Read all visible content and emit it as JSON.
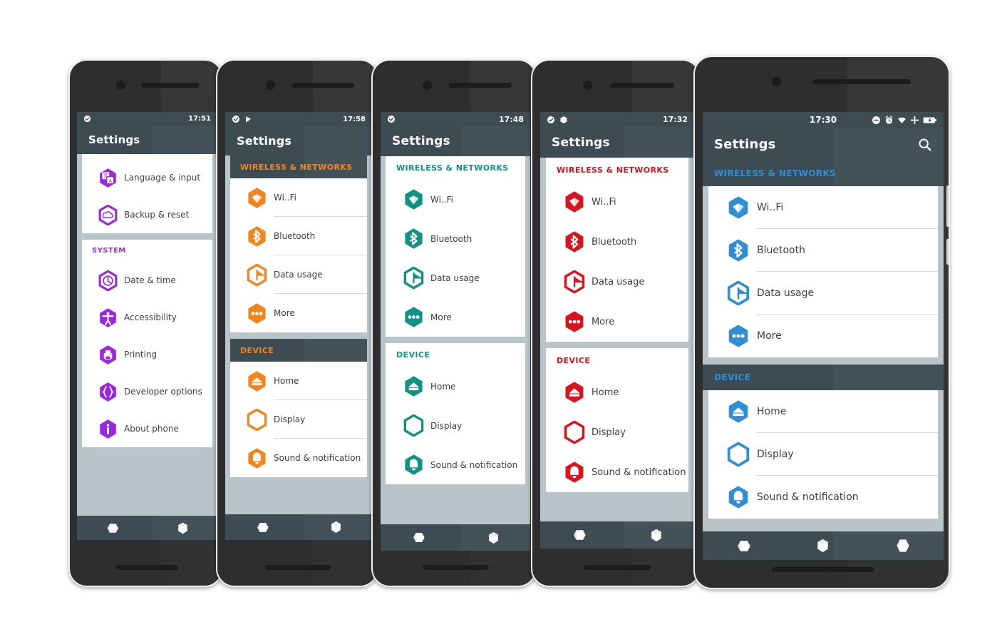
{
  "theme_colors": {
    "purple": "#9C27E0",
    "orange": "#F2851E",
    "teal": "#0E9384",
    "red": "#D91420",
    "blue": "#2E8ED6",
    "bar": "#3d4c52",
    "screen_bg": "#b9c4c9",
    "card": "#ffffff",
    "label": "#3a3f44",
    "divider": "#d8d8d8"
  },
  "section_labels": {
    "wireless": "WIRELESS & NETWORKS",
    "device": "DEVICE",
    "system": "SYSTEM"
  },
  "item_labels": {
    "wifi": "Wi..Fi",
    "bluetooth": "Bluetooth",
    "data_usage": "Data usage",
    "more": "More",
    "home": "Home",
    "display": "Display",
    "sound": "Sound & notification",
    "language": "Language & input",
    "backup": "Backup & reset",
    "datetime": "Date & time",
    "accessibility": "Accessibility",
    "printing": "Printing",
    "developer": "Developer options",
    "about": "About phone"
  },
  "phones": [
    {
      "id": "phone-purple",
      "accent": "#9C27E0",
      "title": "Settings",
      "time": "17:51",
      "status_left": [
        "check-circle-icon"
      ],
      "status_right": [],
      "search_visible": false,
      "section_header_style": "plain-card",
      "dividers": false,
      "nav_buttons": [
        "nav-back",
        "nav-home"
      ],
      "groups": [
        {
          "header": null,
          "items": [
            {
              "icon": "language-icon",
              "label": "Language & input"
            },
            {
              "icon": "backup-icon",
              "label": "Backup & reset"
            }
          ]
        },
        {
          "header": "SYSTEM",
          "items": [
            {
              "icon": "clock-icon",
              "label": "Date & time"
            },
            {
              "icon": "accessibility-icon",
              "label": "Accessibility"
            },
            {
              "icon": "printer-icon",
              "label": "Printing"
            },
            {
              "icon": "braces-icon",
              "label": "Developer options"
            },
            {
              "icon": "info-icon",
              "label": "About phone"
            }
          ]
        }
      ]
    },
    {
      "id": "phone-orange",
      "accent": "#F2851E",
      "title": "Settings",
      "time": "17:58",
      "status_left": [
        "check-circle-icon",
        "play-store-icon"
      ],
      "status_right": [],
      "search_visible": false,
      "section_header_style": "dark-band",
      "dividers": true,
      "nav_buttons": [
        "nav-back",
        "nav-home"
      ],
      "groups": [
        {
          "header": "WIRELESS & NETWORKS",
          "items": [
            {
              "icon": "wifi-icon",
              "label": "Wi..Fi"
            },
            {
              "icon": "bluetooth-icon",
              "label": "Bluetooth"
            },
            {
              "icon": "data-usage-icon",
              "label": "Data usage"
            },
            {
              "icon": "more-icon",
              "label": "More"
            }
          ]
        },
        {
          "header": "DEVICE",
          "items": [
            {
              "icon": "home-icon",
              "label": "Home"
            },
            {
              "icon": "display-icon",
              "label": "Display"
            },
            {
              "icon": "bell-icon",
              "label": "Sound & notification"
            }
          ]
        }
      ]
    },
    {
      "id": "phone-teal",
      "accent": "#0E9384",
      "title": "Settings",
      "time": "17:48",
      "status_left": [
        "check-circle-icon"
      ],
      "status_right": [],
      "search_visible": false,
      "section_header_style": "plain-card",
      "dividers": false,
      "nav_buttons": [
        "nav-back",
        "nav-home"
      ],
      "groups": [
        {
          "header": "WIRELESS & NETWORKS",
          "items": [
            {
              "icon": "wifi-icon",
              "label": "Wi..Fi"
            },
            {
              "icon": "bluetooth-icon",
              "label": "Bluetooth"
            },
            {
              "icon": "data-usage-icon",
              "label": "Data usage"
            },
            {
              "icon": "more-icon",
              "label": "More"
            }
          ]
        },
        {
          "header": "DEVICE",
          "items": [
            {
              "icon": "home-icon",
              "label": "Home"
            },
            {
              "icon": "display-icon",
              "label": "Display"
            },
            {
              "icon": "bell-icon",
              "label": "Sound & notification"
            }
          ]
        }
      ]
    },
    {
      "id": "phone-red",
      "accent": "#D91420",
      "title": "Settings",
      "time": "17:32",
      "status_left": [
        "check-circle-icon",
        "hexagon-icon"
      ],
      "status_right": [],
      "search_visible": false,
      "section_header_style": "plain-card",
      "dividers": false,
      "nav_buttons": [
        "nav-back",
        "nav-home"
      ],
      "groups": [
        {
          "header": "WIRELESS & NETWORKS",
          "items": [
            {
              "icon": "wifi-icon",
              "label": "Wi..Fi"
            },
            {
              "icon": "bluetooth-icon",
              "label": "Bluetooth"
            },
            {
              "icon": "data-usage-icon",
              "label": "Data usage"
            },
            {
              "icon": "more-icon",
              "label": "More"
            }
          ]
        },
        {
          "header": "DEVICE",
          "items": [
            {
              "icon": "home-icon",
              "label": "Home"
            },
            {
              "icon": "display-icon",
              "label": "Display"
            },
            {
              "icon": "bell-icon",
              "label": "Sound & notification"
            }
          ]
        }
      ]
    },
    {
      "id": "phone-blue",
      "accent": "#2E8ED6",
      "title": "Settings",
      "time": "17:30",
      "status_left": [],
      "status_right": [
        "do-not-disturb-icon",
        "alarm-icon",
        "wifi-status-icon",
        "plus-icon",
        "battery-icon"
      ],
      "search_visible": true,
      "section_header_style": "dark-band",
      "dividers": true,
      "nav_buttons": [
        "nav-back",
        "nav-home",
        "nav-recents"
      ],
      "groups": [
        {
          "header": "WIRELESS & NETWORKS",
          "items": [
            {
              "icon": "wifi-icon",
              "label": "Wi..Fi"
            },
            {
              "icon": "bluetooth-icon",
              "label": "Bluetooth"
            },
            {
              "icon": "data-usage-icon",
              "label": "Data usage"
            },
            {
              "icon": "more-icon",
              "label": "More"
            }
          ]
        },
        {
          "header": "DEVICE",
          "items": [
            {
              "icon": "home-icon",
              "label": "Home"
            },
            {
              "icon": "display-icon",
              "label": "Display"
            },
            {
              "icon": "bell-icon",
              "label": "Sound & notification"
            }
          ]
        }
      ]
    }
  ]
}
